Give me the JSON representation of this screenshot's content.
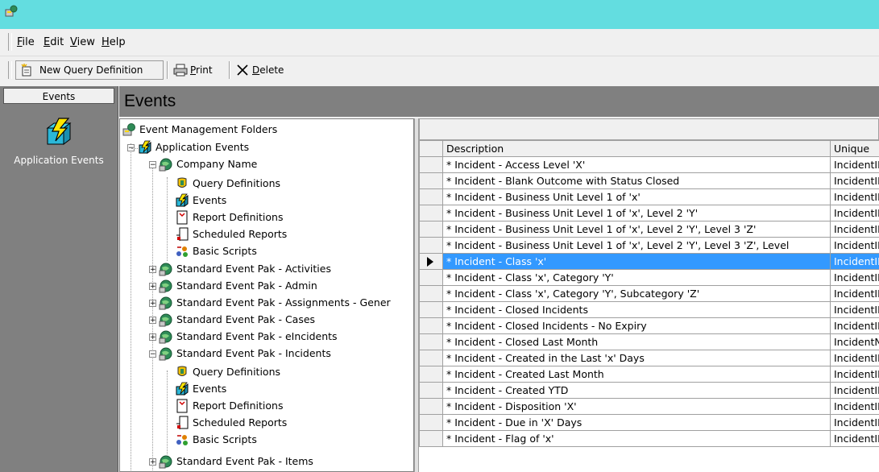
{
  "menu": {
    "file": "File",
    "edit": "Edit",
    "view": "View",
    "help": "Help"
  },
  "toolbar": {
    "new_query": "New Query Definition",
    "print": "Print",
    "delete": "Delete"
  },
  "sidebar": {
    "header": "Events",
    "item_label": "Application Events"
  },
  "main": {
    "title": "Events"
  },
  "tree": {
    "root": "Event Management Folders",
    "application_events": "Application Events",
    "company": "Company Name",
    "company_children": [
      "Query Definitions",
      "Events",
      "Report Definitions",
      "Scheduled Reports",
      "Basic Scripts"
    ],
    "paks": [
      "Standard Event Pak - Activities",
      "Standard Event Pak - Admin",
      "Standard Event Pak - Assignments - Gener",
      "Standard Event Pak - Cases",
      "Standard Event Pak - eIncidents",
      "Standard Event Pak - Incidents"
    ],
    "incidents_children": [
      "Query Definitions",
      "Events",
      "Report Definitions",
      "Scheduled Reports",
      "Basic Scripts"
    ],
    "items": "Standard Event Pak - Items"
  },
  "grid": {
    "columns": {
      "description": "Description",
      "unique": "Unique"
    },
    "selected_index": 6,
    "rows": [
      {
        "description": "* Incident - Access Level 'X'",
        "unique": "IncidentID"
      },
      {
        "description": "* Incident - Blank Outcome with Status Closed",
        "unique": "IncidentID"
      },
      {
        "description": "* Incident - Business Unit Level 1 of 'x'",
        "unique": "IncidentID"
      },
      {
        "description": "* Incident - Business Unit Level 1 of 'x', Level 2 'Y'",
        "unique": "IncidentID"
      },
      {
        "description": "* Incident - Business Unit Level 1 of 'x', Level 2 'Y', Level 3 'Z'",
        "unique": "IncidentID"
      },
      {
        "description": "* Incident - Business Unit Level 1 of 'x', Level 2 'Y', Level 3 'Z', Level",
        "unique": "IncidentID"
      },
      {
        "description": "* Incident - Class 'x'",
        "unique": "IncidentID"
      },
      {
        "description": "* Incident - Class 'x', Category 'Y'",
        "unique": "IncidentID"
      },
      {
        "description": "* Incident - Class 'x', Category 'Y', Subcategory 'Z'",
        "unique": "IncidentID"
      },
      {
        "description": "* Incident - Closed Incidents",
        "unique": "IncidentID"
      },
      {
        "description": "* Incident - Closed Incidents - No Expiry",
        "unique": "IncidentID"
      },
      {
        "description": "* Incident - Closed Last Month",
        "unique": "IncidentNum"
      },
      {
        "description": "* Incident - Created in the Last 'x' Days",
        "unique": "IncidentID"
      },
      {
        "description": "* Incident - Created Last Month",
        "unique": "IncidentID"
      },
      {
        "description": "* Incident - Created YTD",
        "unique": "IncidentID"
      },
      {
        "description": "* Incident - Disposition 'X'",
        "unique": "IncidentID"
      },
      {
        "description": "* Incident - Due in 'X' Days",
        "unique": "IncidentID"
      },
      {
        "description": "* Incident - Flag of 'x'",
        "unique": "IncidentID"
      }
    ]
  }
}
